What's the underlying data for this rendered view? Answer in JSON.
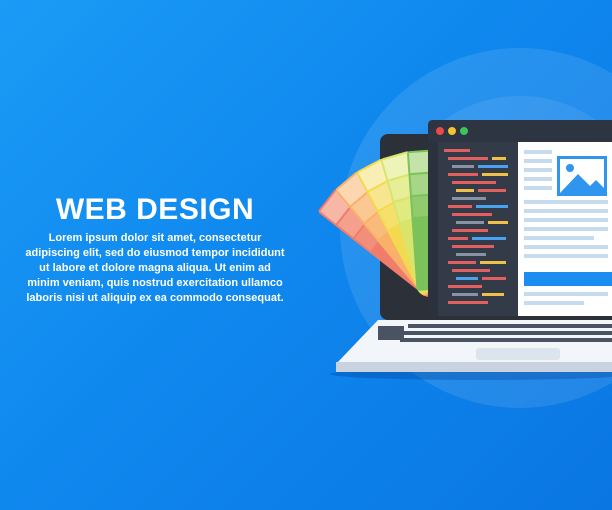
{
  "hero": {
    "headline": "WEB DESIGN",
    "body": "Lorem ipsum dolor sit amet, consectetur adipiscing elit, sed do eiusmod tempor incididunt ut labore et dolore magna aliqua. Ut enim ad minim veniam, quis nostrud exercitation ullamco laboris nisi ut aliquip ex ea commodo consequat."
  },
  "illustration": {
    "subject": "laptop",
    "icons": [
      "laptop-icon",
      "browser-window-icon",
      "code-editor-icon",
      "image-placeholder-icon",
      "color-palette-icon",
      "keyboard-icon"
    ]
  },
  "colors": {
    "background": "#1b9bf6",
    "window_dot_red": "#e94a4a",
    "window_dot_yellow": "#f4c430",
    "window_dot_green": "#3bc55a",
    "accent_blue": "#1b8cf0"
  }
}
